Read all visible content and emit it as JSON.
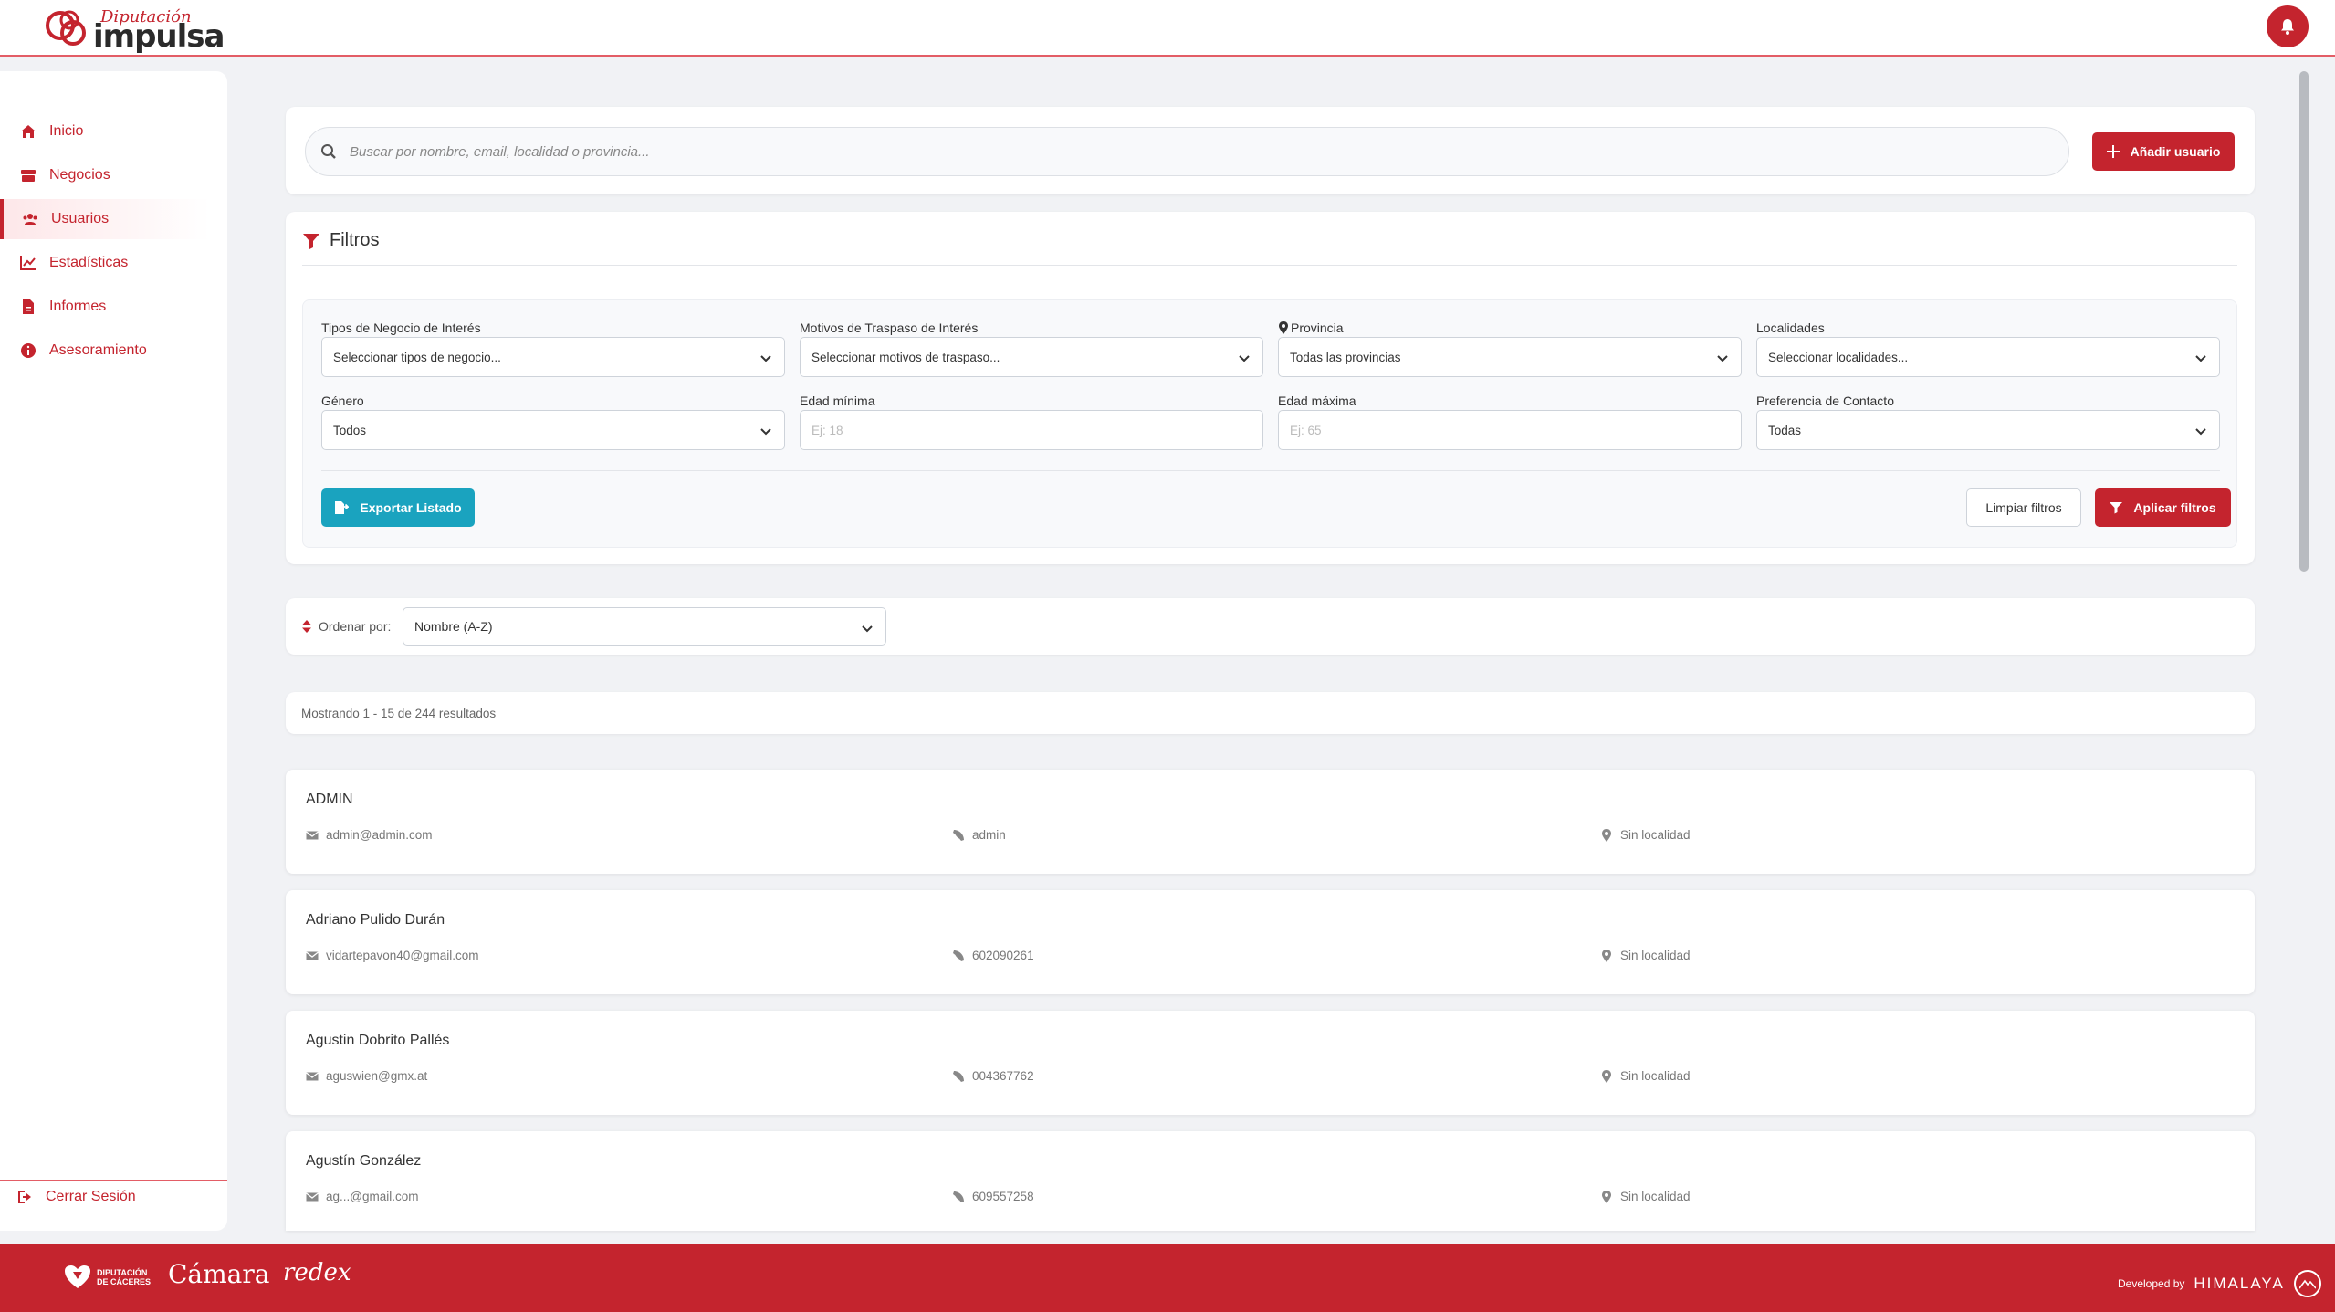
{
  "header": {
    "logo_script": "Diputación",
    "logo_word": "impulsa"
  },
  "sidebar": {
    "items": [
      {
        "label": "Inicio",
        "icon": "home-icon"
      },
      {
        "label": "Negocios",
        "icon": "store-icon"
      },
      {
        "label": "Usuarios",
        "icon": "users-icon",
        "active": true
      },
      {
        "label": "Estadísticas",
        "icon": "chart-line-icon"
      },
      {
        "label": "Informes",
        "icon": "file-icon"
      },
      {
        "label": "Asesoramiento",
        "icon": "info-circle-icon"
      }
    ],
    "logout_label": "Cerrar Sesión"
  },
  "search": {
    "placeholder": "Buscar por nombre, email, localidad o provincia...",
    "add_label": "Añadir usuario"
  },
  "filters": {
    "title": "Filtros",
    "tipos_label": "Tipos de Negocio de Interés",
    "tipos_value": "Seleccionar tipos de negocio...",
    "motivos_label": "Motivos de Traspaso de Interés",
    "motivos_value": "Seleccionar motivos de traspaso...",
    "provincia_label": "Provincia",
    "provincia_value": "Todas las provincias",
    "localidades_label": "Localidades",
    "localidades_value": "Seleccionar localidades...",
    "genero_label": "Género",
    "genero_value": "Todos",
    "edad_min_label": "Edad mínima",
    "edad_min_placeholder": "Ej: 18",
    "edad_max_label": "Edad máxima",
    "edad_max_placeholder": "Ej: 65",
    "contacto_label": "Preferencia de Contacto",
    "contacto_value": "Todas",
    "export_label": "Exportar Listado",
    "clear_label": "Limpiar filtros",
    "apply_label": "Aplicar filtros"
  },
  "sort": {
    "label": "Ordenar por:",
    "value": "Nombre (A-Z)"
  },
  "results": {
    "text": "Mostrando 1 - 15 de 244 resultados"
  },
  "users": [
    {
      "name": "ADMIN",
      "email": "admin@admin.com",
      "phone": "admin",
      "location": "Sin localidad"
    },
    {
      "name": "Adriano Pulido Durán",
      "email": "vidartepavon40@gmail.com",
      "phone": "602090261",
      "location": "Sin localidad"
    },
    {
      "name": "Agustin Dobrito Pallés",
      "email": "aguswien@gmx.at",
      "phone": "004367762",
      "location": "Sin localidad"
    },
    {
      "name": "Agustín González",
      "email": "ag...@gmail.com",
      "phone": "609557258",
      "location": "Sin localidad"
    }
  ],
  "footer": {
    "diputacion_line1": "DIPUTACIÓN",
    "diputacion_line2": "DE CÁCERES",
    "camara": "Cámara",
    "redex": "redex",
    "developed_by": "Developed by",
    "developer_brand": "HIMALAYA"
  },
  "colors": {
    "brand_red": "#c4242e",
    "teal": "#1aa3bf"
  }
}
